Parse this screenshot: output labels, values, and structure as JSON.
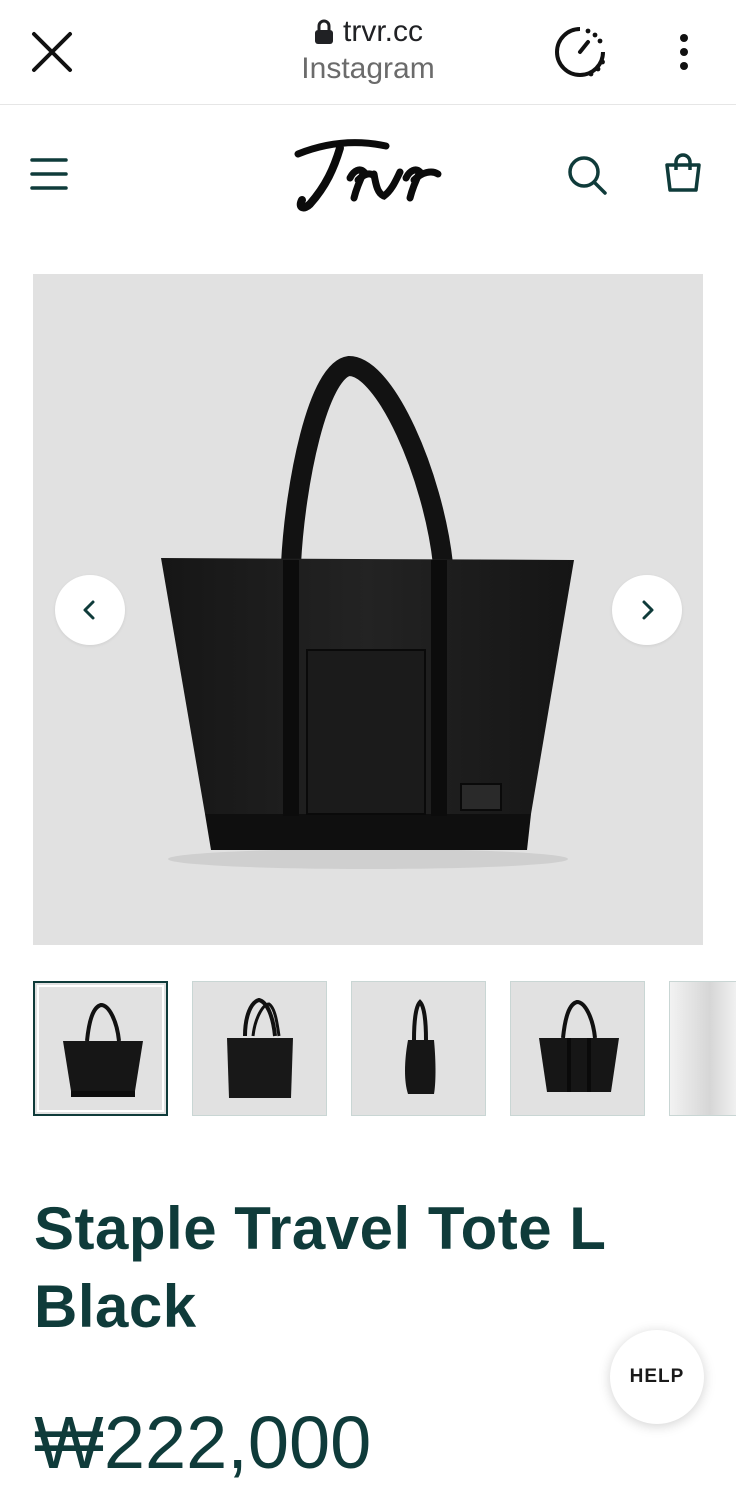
{
  "browser": {
    "domain": "trvr.cc",
    "subtitle": "Instagram"
  },
  "header": {
    "logo_text": "Trvr"
  },
  "icons": {
    "close": "close-icon",
    "lock": "lock-icon",
    "timer": "timer-icon",
    "more": "more-vertical-icon",
    "menu": "menu-icon",
    "search": "search-icon",
    "bag": "shopping-bag-icon",
    "prev": "chevron-left-icon",
    "next": "chevron-right-icon"
  },
  "gallery": {
    "selected_index": 0,
    "thumbnails": [
      "front",
      "angle",
      "side",
      "front-alt",
      "partial"
    ]
  },
  "product": {
    "title": "Staple Travel Tote L Black",
    "price": "₩222,000"
  },
  "help": {
    "label": "HELP"
  },
  "colors": {
    "brand_text": "#0f3b3a",
    "image_bg": "#e1e1e1"
  }
}
